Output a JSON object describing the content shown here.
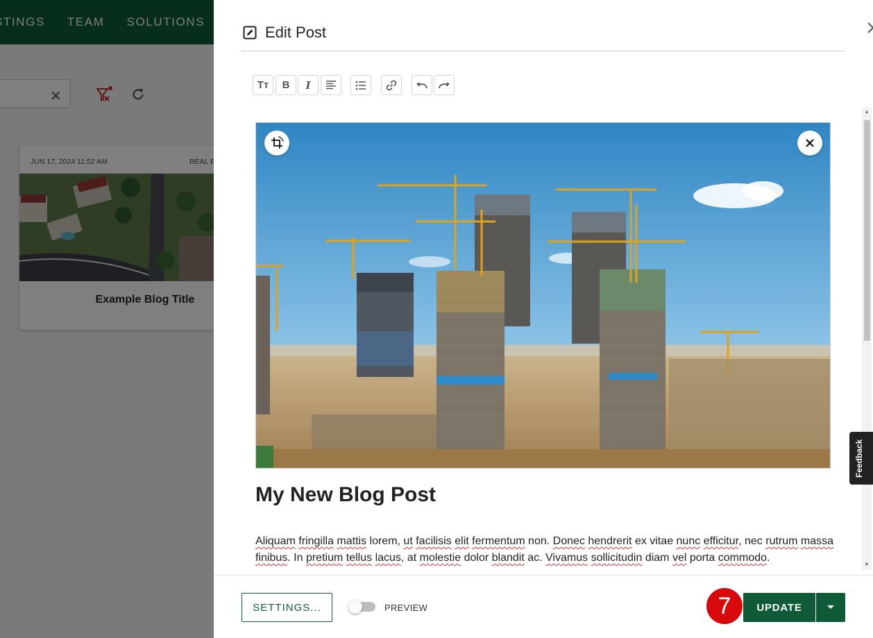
{
  "background": {
    "nav": [
      "STINGS",
      "TEAM",
      "SOLUTIONS"
    ],
    "card": {
      "date": "JUN 17, 2024 11:52 AM",
      "category": "REAL E",
      "title": "Example Blog Title"
    }
  },
  "dialog": {
    "title": "Edit Post",
    "toolbar_icons": [
      "text-size-icon",
      "bold-icon",
      "italic-icon",
      "align-left-icon",
      "bulleted-list-icon",
      "link-icon",
      "undo-icon",
      "redo-icon"
    ],
    "toolbar_glyphs": {
      "text_size": "Tт",
      "bold": "B",
      "italic": "I"
    },
    "post": {
      "title": "My New Blog Post",
      "body_segments": [
        {
          "t": "Aliquam",
          "s": true
        },
        {
          "t": " "
        },
        {
          "t": "fringilla",
          "s": true
        },
        {
          "t": " "
        },
        {
          "t": "mattis",
          "s": true
        },
        {
          "t": " lorem, "
        },
        {
          "t": "ut",
          "s": true
        },
        {
          "t": " "
        },
        {
          "t": "facilisis",
          "s": true
        },
        {
          "t": " "
        },
        {
          "t": "elit",
          "s": true
        },
        {
          "t": " "
        },
        {
          "t": "fermentum",
          "s": true
        },
        {
          "t": " non. "
        },
        {
          "t": "Donec",
          "s": true
        },
        {
          "t": " "
        },
        {
          "t": "hendrerit",
          "s": true
        },
        {
          "t": " ex vitae "
        },
        {
          "t": "nunc",
          "s": true
        },
        {
          "t": " "
        },
        {
          "t": "efficitur",
          "s": true
        },
        {
          "t": ", nec "
        },
        {
          "t": "rutrum",
          "s": true
        },
        {
          "t": " "
        },
        {
          "t": "massa",
          "s": true
        },
        {
          "t": " "
        },
        {
          "t": "finibus",
          "s": true
        },
        {
          "t": ". In "
        },
        {
          "t": "pretium",
          "s": true
        },
        {
          "t": " "
        },
        {
          "t": "tellus",
          "s": true
        },
        {
          "t": " "
        },
        {
          "t": "lacus",
          "s": true
        },
        {
          "t": ", at "
        },
        {
          "t": "molestie",
          "s": true
        },
        {
          "t": " dolor "
        },
        {
          "t": "blandit",
          "s": true
        },
        {
          "t": " ac. "
        },
        {
          "t": "Vivamus",
          "s": true
        },
        {
          "t": " "
        },
        {
          "t": "sollicitudin",
          "s": true
        },
        {
          "t": " diam "
        },
        {
          "t": "vel",
          "s": true
        },
        {
          "t": " porta "
        },
        {
          "t": "commodo",
          "s": true
        },
        {
          "t": "."
        }
      ]
    },
    "footer": {
      "settings_label": "SETTINGS...",
      "preview_label": "PREVIEW",
      "preview_on": false,
      "step_number": "7",
      "update_label": "UPDATE"
    }
  },
  "feedback_label": "Feedback",
  "colors": {
    "brand_green": "#0f5b37",
    "step_badge": "#d60a0a",
    "divider": "#b8d6c9"
  }
}
